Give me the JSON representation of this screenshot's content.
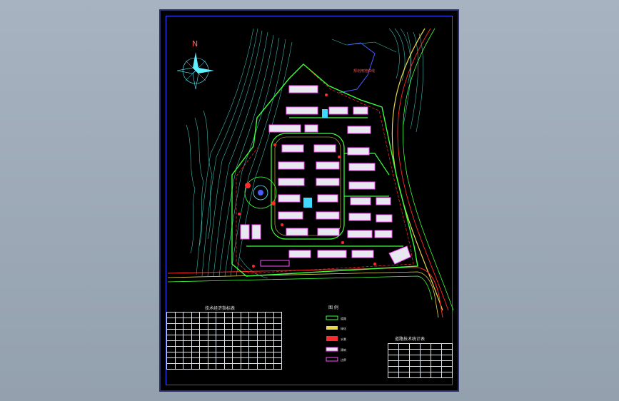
{
  "drawing": {
    "north_label": "N",
    "legend_title": "图 例",
    "table_left_title": "技术经济指标表",
    "table_right_title": "道路技术统计表",
    "red_label": "规划用地红线",
    "legend_items": [
      "道路",
      "绿化",
      "水景",
      "建筑",
      "边界"
    ]
  },
  "colors": {
    "background": "#000000",
    "sheet_border": "#3b4bff",
    "road_green": "#3cff3c",
    "building_magenta": "#ff4cff",
    "building_white": "#e8e8f0",
    "terrain_cyan": "#3fb9b0",
    "boundary_red": "#ff2a2a",
    "road_yellow": "#e8d84a"
  }
}
